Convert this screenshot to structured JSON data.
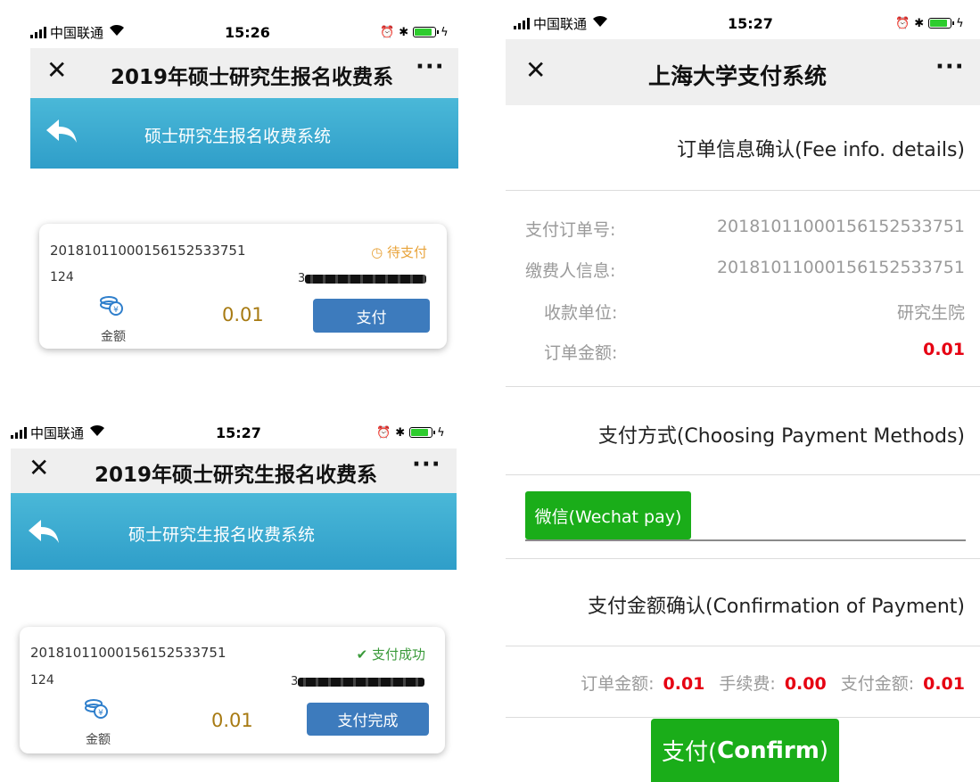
{
  "status": {
    "carrier": "中国联通",
    "time_top_left": "15:26",
    "time_bottom_left": "15:27",
    "time_right": "15:27"
  },
  "left_screens": {
    "nav_title": "2019年硕士研究生报名收费系",
    "app_title": "硕士研究生报名收费系统",
    "card_top": {
      "order_no": "2018101100015615253375​1",
      "status": "待支付",
      "status_color": "#e8a33a",
      "code_prefix": "124",
      "redacted_lead": "3",
      "amount_label": "金额",
      "amount": "0.01",
      "button_label": "支付"
    },
    "card_bottom": {
      "order_no": "2018101100015615253375​1",
      "status": "支付成功",
      "status_color": "#3a9a3a",
      "code_prefix": "124",
      "redacted_lead": "3",
      "amount_label": "金额",
      "amount": "0.01",
      "button_label": "支付完成"
    }
  },
  "right_screen": {
    "nav_title": "上海大学支付系统",
    "order_section_title": "订单信息确认(Fee info. details)",
    "fields": [
      {
        "label": "支付订单号:",
        "value": "201810110001561525337​51"
      },
      {
        "label": "缴费人信息:",
        "value": "201810110001561525337​51"
      },
      {
        "label": "收款单位:",
        "value": "研究生院"
      },
      {
        "label": "订单金额:",
        "value": "0.01"
      }
    ],
    "method_section_title": "支付方式(Choosing Payment Methods)",
    "wechat_button": "微信(Wechat pay)",
    "confirm_section_title": "支付金额确认(Confirmation of Payment)",
    "fee_summary": {
      "order_amount_label": "订单金额:",
      "order_amount": "0.01",
      "fee_label": "手续费:",
      "fee": "0.00",
      "pay_amount_label": "支付金额:",
      "pay_amount": "0.01"
    },
    "confirm_button_cn": "支付(",
    "confirm_button_en": "Confirm",
    "confirm_button_close": ")"
  },
  "colors": {
    "wechat_green": "#1aad19",
    "app_blue": "#2f9ec9",
    "pay_button_blue": "#3d7bbd",
    "amount_red": "#e60012"
  }
}
